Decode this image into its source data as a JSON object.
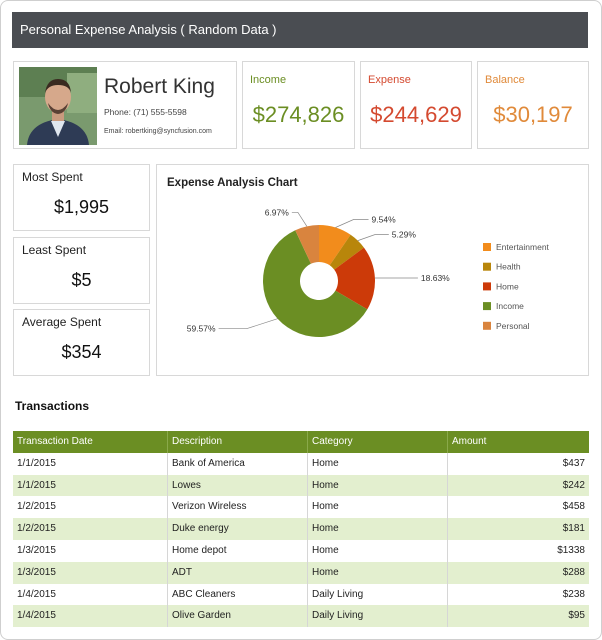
{
  "window": {
    "title": "Personal Expense Analysis ( Random Data )"
  },
  "profile": {
    "name": "Robert King",
    "phone": "Phone: (71) 555-5598",
    "email": "Email: robertking@syncfusion.com"
  },
  "kpis": {
    "income": {
      "label": "Income",
      "value": "$274,826"
    },
    "expense": {
      "label": "Expense",
      "value": "$244,629"
    },
    "balance": {
      "label": "Balance",
      "value": "$30,197"
    }
  },
  "stats": {
    "most": {
      "label": "Most Spent",
      "value": "$1,995"
    },
    "least": {
      "label": "Least Spent",
      "value": "$5"
    },
    "average": {
      "label": "Average Spent",
      "value": "$354"
    }
  },
  "colors": {
    "accent": "#6b8e23",
    "income_text": "#6b8e23",
    "expense_text": "#d44a30",
    "balance_text": "#e08a3a",
    "titlebar": "#4a4d52",
    "row_alt": "#e3efcf"
  },
  "chart_data": {
    "type": "pie",
    "title": "Expense Analysis Chart",
    "donut": true,
    "legend_position": "right",
    "categories": [
      "Entertainment",
      "Health",
      "Home",
      "Income",
      "Personal"
    ],
    "values": [
      9.54,
      5.29,
      18.63,
      59.57,
      6.97
    ],
    "labels": [
      "9.54%",
      "5.29%",
      "18.63%",
      "59.57%",
      "6.97%"
    ],
    "colors": [
      "#f28c1c",
      "#b8860b",
      "#cc3a09",
      "#6b8e23",
      "#d9843e"
    ]
  },
  "transactions": {
    "title": "Transactions",
    "columns": [
      "Transaction Date",
      "Description",
      "Category",
      "Amount"
    ],
    "rows": [
      [
        "1/1/2015",
        "Bank of America",
        "Home",
        "$437"
      ],
      [
        "1/1/2015",
        "Lowes",
        "Home",
        "$242"
      ],
      [
        "1/2/2015",
        "Verizon Wireless",
        "Home",
        "$458"
      ],
      [
        "1/2/2015",
        "Duke energy",
        "Home",
        "$181"
      ],
      [
        "1/3/2015",
        "Home depot",
        "Home",
        "$1338"
      ],
      [
        "1/3/2015",
        "ADT",
        "Home",
        "$288"
      ],
      [
        "1/4/2015",
        "ABC Cleaners",
        "Daily Living",
        "$238"
      ],
      [
        "1/4/2015",
        "Olive Garden",
        "Daily Living",
        "$95"
      ]
    ]
  }
}
